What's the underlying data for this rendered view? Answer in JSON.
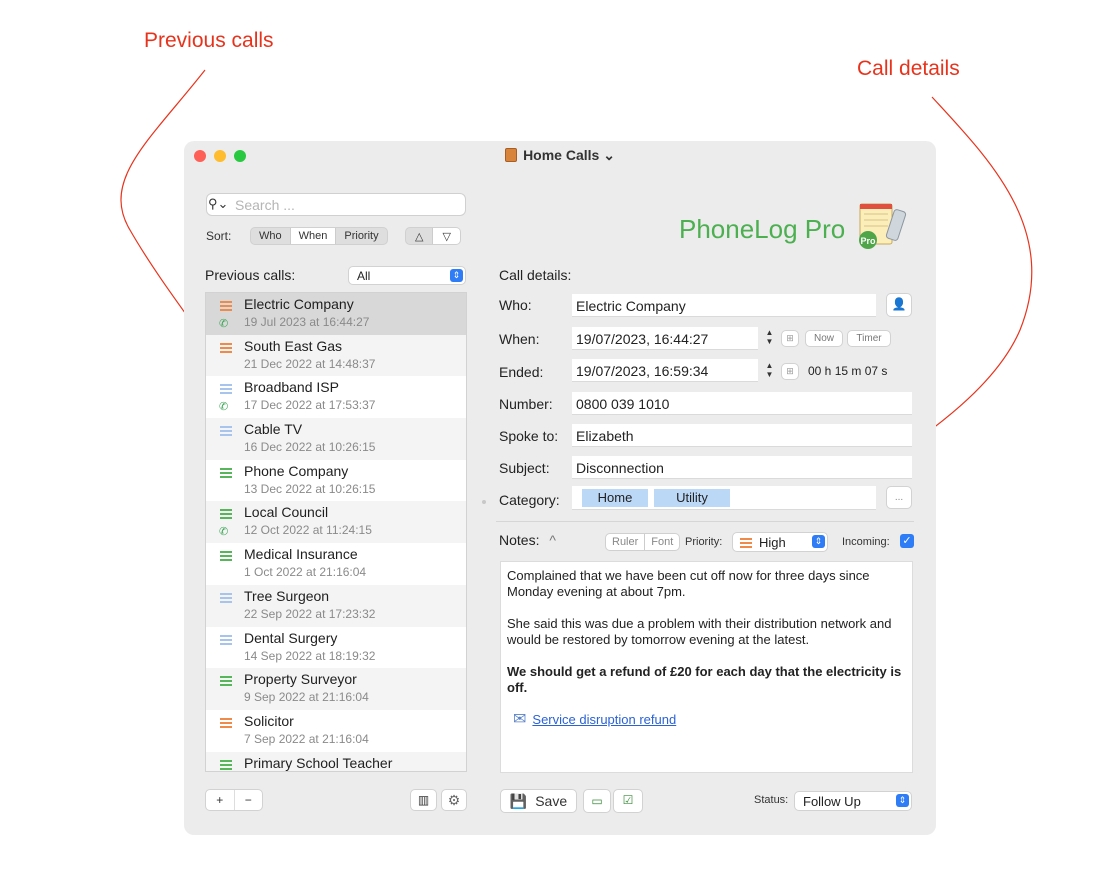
{
  "annotations": {
    "previous_calls": "Previous calls",
    "call_details": "Call details"
  },
  "window": {
    "title": "Home Calls",
    "title_suffix": "⌄"
  },
  "search": {
    "placeholder": "Search ..."
  },
  "sort": {
    "label": "Sort:",
    "options": [
      "Who",
      "When",
      "Priority"
    ],
    "selected": "When",
    "order_up": "△",
    "order_down": "▽"
  },
  "previous_calls": {
    "label": "Previous calls:",
    "filter": "All",
    "items": [
      {
        "name": "Electric Company",
        "date": "19 Jul 2023 at 16:44:27",
        "priority": "high",
        "incoming": true
      },
      {
        "name": "South East Gas",
        "date": "21 Dec 2022 at 14:48:37",
        "priority": "high",
        "incoming": false
      },
      {
        "name": "Broadband ISP",
        "date": "17 Dec 2022 at 17:53:37",
        "priority": "low",
        "incoming": true
      },
      {
        "name": "Cable TV",
        "date": "16 Dec 2022 at 10:26:15",
        "priority": "low",
        "incoming": false
      },
      {
        "name": "Phone Company",
        "date": "13 Dec 2022 at 10:26:15",
        "priority": "normal",
        "incoming": false
      },
      {
        "name": "Local Council",
        "date": "12 Oct 2022 at 11:24:15",
        "priority": "normal",
        "incoming": true
      },
      {
        "name": "Medical Insurance",
        "date": "1 Oct 2022 at 21:16:04",
        "priority": "normal",
        "incoming": false
      },
      {
        "name": "Tree Surgeon",
        "date": "22 Sep 2022 at 17:23:32",
        "priority": "low",
        "incoming": false
      },
      {
        "name": "Dental Surgery",
        "date": "14 Sep 2022 at 18:19:32",
        "priority": "low",
        "incoming": false
      },
      {
        "name": "Property Surveyor",
        "date": "9 Sep 2022 at 21:16:04",
        "priority": "normal",
        "incoming": false
      },
      {
        "name": "Solicitor",
        "date": "7 Sep 2022 at 21:16:04",
        "priority": "high",
        "incoming": false
      },
      {
        "name": "Primary School Teacher",
        "date": "",
        "priority": "normal",
        "incoming": false
      }
    ]
  },
  "priority_colors": {
    "high": "#f08a4b",
    "normal": "#57b65a",
    "low": "#a9c4ec"
  },
  "footer_left": {
    "add": "+",
    "remove": "−"
  },
  "brand": {
    "name": "PhoneLog Pro",
    "badge": "Pro"
  },
  "call_details": {
    "label": "Call details:",
    "who_label": "Who:",
    "who": "Electric Company",
    "when_label": "When:",
    "when": "19/07/2023, 16:44:27",
    "now_button": "Now",
    "timer_button": "Timer",
    "ended_label": "Ended:",
    "ended": "19/07/2023, 16:59:34",
    "duration": "00 h  15 m  07 s",
    "number_label": "Number:",
    "number": "0800 039 1010",
    "spoke_label": "Spoke to:",
    "spoke": "Elizabeth",
    "subject_label": "Subject:",
    "subject": "Disconnection",
    "category_label": "Category:",
    "categories": [
      "Home",
      "Utility"
    ],
    "more_button": "..."
  },
  "notes": {
    "label": "Notes:",
    "toggle": "^",
    "ruler": "Ruler",
    "font": "Font",
    "priority_label": "Priority:",
    "priority": "High",
    "incoming_label": "Incoming:",
    "incoming_checked": true,
    "para1": "Complained that we have been cut off now for three days since Monday evening at about 7pm.",
    "para2": "She said this was due a problem with their distribution network and would be restored by tomorrow evening at the latest.",
    "para3": "We should get a refund of £20 for each day that the electricity is off.",
    "link": "Service disruption refund"
  },
  "footer_right": {
    "save": "Save",
    "status_label": "Status:",
    "status": "Follow Up"
  }
}
